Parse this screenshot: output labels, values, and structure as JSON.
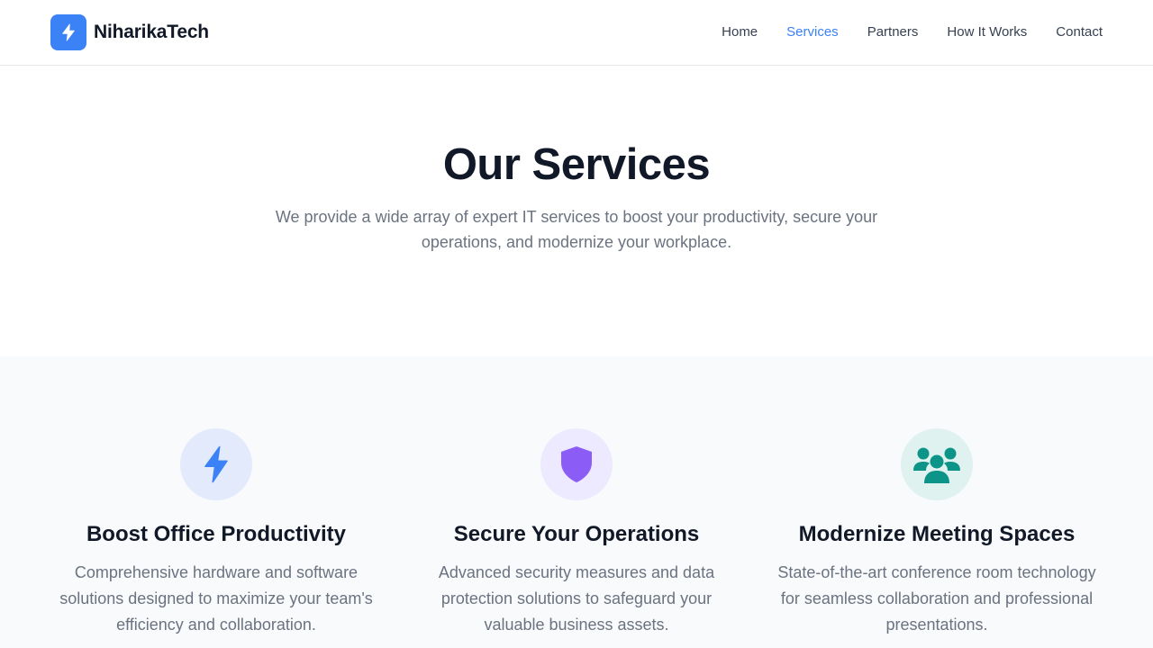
{
  "header": {
    "brand_name": "NiharikaTech",
    "logo_icon": "lightning-bolt-icon",
    "nav": [
      {
        "label": "Home",
        "active": false
      },
      {
        "label": "Services",
        "active": true
      },
      {
        "label": "Partners",
        "active": false
      },
      {
        "label": "How It Works",
        "active": false
      },
      {
        "label": "Contact",
        "active": false
      }
    ]
  },
  "hero": {
    "title": "Our Services",
    "subtitle": "We provide a wide array of expert IT services to boost your productivity, secure your operations, and modernize your workplace."
  },
  "services": [
    {
      "icon": "lightning-bolt-icon",
      "title": "Boost Office Productivity",
      "description": "Comprehensive hardware and software solutions designed to maximize your team's efficiency and collaboration."
    },
    {
      "icon": "shield-icon",
      "title": "Secure Your Operations",
      "description": "Advanced security measures and data protection solutions to safeguard your valuable business assets."
    },
    {
      "icon": "users-group-icon",
      "title": "Modernize Meeting Spaces",
      "description": "State-of-the-art conference room technology for seamless collaboration and professional presentations."
    }
  ],
  "colors": {
    "accent": "#3b82f6",
    "purple": "#8b5cf6",
    "teal": "#0d9488",
    "heading": "#111827",
    "muted": "#6b7280",
    "section_bg": "#f8fafc"
  }
}
